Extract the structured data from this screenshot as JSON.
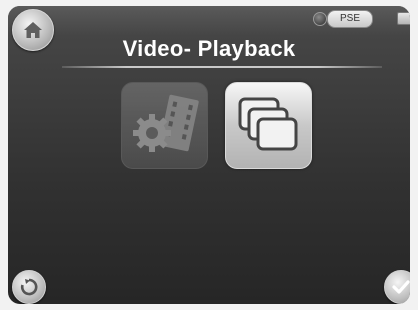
{
  "header": {
    "title": "Video- Playback",
    "status_badge": "PSE"
  },
  "icons": {
    "home": "home-icon",
    "indicator": "indicator-dot-icon",
    "battery": "battery-icon",
    "settings_tile": "gear-film-icon",
    "playback_tile": "stacked-windows-icon",
    "back": "refresh-icon",
    "confirm": "checkmark-icon"
  },
  "tiles": {
    "settings_state": "disabled",
    "playback_state": "active"
  },
  "colors": {
    "screen_background": "#3a3a3a",
    "title_text": "#ffffff",
    "button_silver": "#c8c8c8"
  }
}
